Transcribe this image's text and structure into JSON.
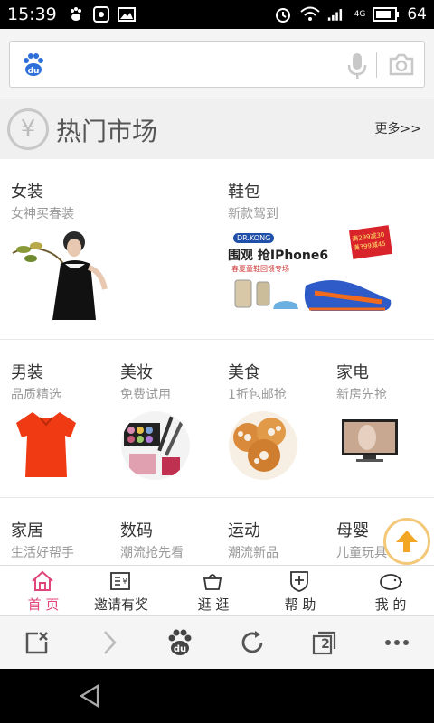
{
  "status": {
    "time": "15:39",
    "battery": "64",
    "network": "4G"
  },
  "search": {
    "placeholder": ""
  },
  "market": {
    "title": "热门市场",
    "more": "更多>>"
  },
  "row1": [
    {
      "title": "女装",
      "sub": "女神买春装"
    },
    {
      "title": "鞋包",
      "sub": "新款驾到"
    }
  ],
  "promo": {
    "brand": "DR.KONG",
    "headline": "围观 抢IPhone6",
    "subline": "春夏童鞋回馈专场",
    "badge1": "满299减30",
    "badge2": "满399减45"
  },
  "row2": [
    {
      "title": "男装",
      "sub": "品质精选"
    },
    {
      "title": "美妆",
      "sub": "免费试用"
    },
    {
      "title": "美食",
      "sub": "1折包邮抢"
    },
    {
      "title": "家电",
      "sub": "新房先抢"
    }
  ],
  "row3": [
    {
      "title": "家居",
      "sub": "生活好帮手"
    },
    {
      "title": "数码",
      "sub": "潮流抢先看"
    },
    {
      "title": "运动",
      "sub": "潮流新品"
    },
    {
      "title": "母婴",
      "sub": "儿童玩具"
    }
  ],
  "nav": [
    {
      "label": "首 页"
    },
    {
      "label": "邀请有奖"
    },
    {
      "label": "逛 逛"
    },
    {
      "label": "帮 助"
    },
    {
      "label": "我 的"
    }
  ],
  "toolbar": {
    "tabs_count": "2"
  },
  "colors": {
    "accent": "#e0457b",
    "baidu_blue": "#2e6fd9",
    "up_button": "#f3a623"
  }
}
